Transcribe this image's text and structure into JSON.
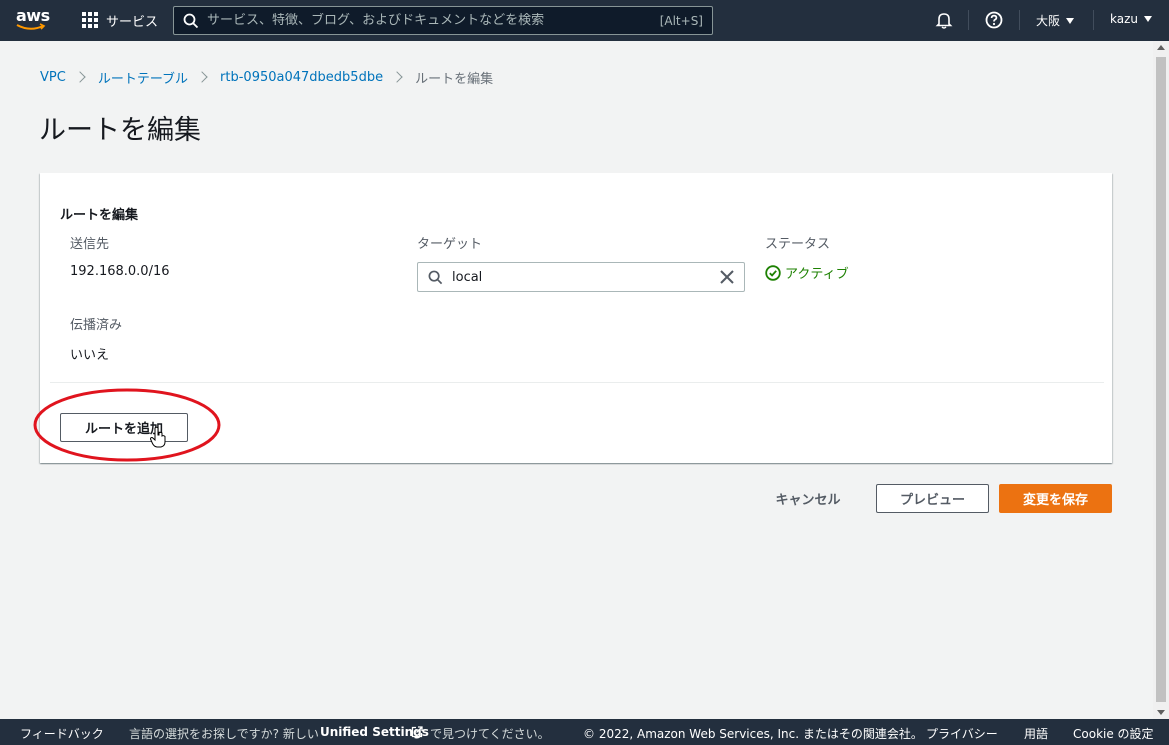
{
  "topnav": {
    "logo_text": "aws",
    "services_label": "サービス",
    "search_placeholder": "サービス、特徴、ブログ、およびドキュメントなどを検索",
    "search_shortcut": "[Alt+S]",
    "region_label": "大阪",
    "user_label": "kazu"
  },
  "breadcrumb": {
    "items": [
      "VPC",
      "ルートテーブル",
      "rtb-0950a047dbedb5dbe"
    ],
    "current": "ルートを編集"
  },
  "page_title": "ルートを編集",
  "panel": {
    "heading": "ルートを編集",
    "destination_label": "送信先",
    "destination_value": "192.168.0.0/16",
    "target_label": "ターゲット",
    "target_value": "local",
    "status_label": "ステータス",
    "status_value": "アクティブ",
    "propagated_label": "伝播済み",
    "propagated_value": "いいえ",
    "add_route_label": "ルートを追加"
  },
  "actions": {
    "cancel_label": "キャンセル",
    "preview_label": "プレビュー",
    "save_label": "変更を保存"
  },
  "footer": {
    "feedback": "フィードバック",
    "language_text": "言語の選択をお探しですか? 新しい",
    "unified_settings": "Unified Settings",
    "language_text_after": "で見つけてください。",
    "copyright": "© 2022, Amazon Web Services, Inc. またはその関連会社。",
    "privacy": "プライバシー",
    "terms": "用語",
    "cookie": "Cookie の設定"
  },
  "colors": {
    "nav_bg": "#232f3e",
    "link": "#0073bb",
    "status_green": "#1d8102",
    "primary_orange": "#ec7211",
    "highlight_red": "#e0141e"
  }
}
